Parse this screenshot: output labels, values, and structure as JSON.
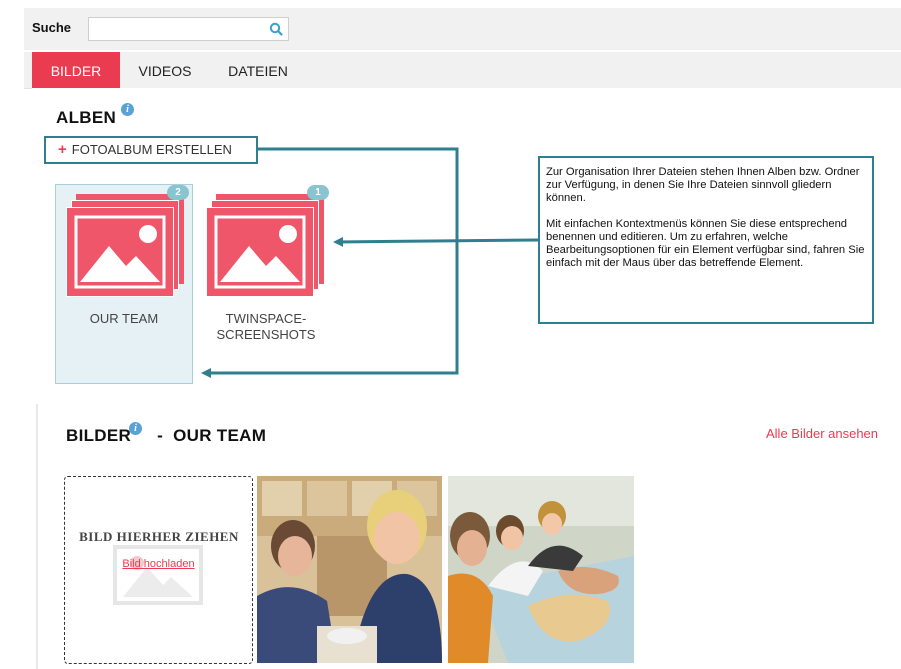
{
  "search": {
    "label": "Suche",
    "value": "",
    "placeholder": ""
  },
  "tabs": [
    {
      "label": "BILDER",
      "active": true
    },
    {
      "label": "VIDEOS",
      "active": false
    },
    {
      "label": "DATEIEN",
      "active": false
    }
  ],
  "albums_section": {
    "heading": "ALBEN",
    "info": "i",
    "create_button": {
      "plus": "+",
      "label": "FOTOALBUM ERSTELLEN"
    },
    "albums": [
      {
        "title": "OUR TEAM",
        "count": "2",
        "selected": true
      },
      {
        "title_line1": "TWINSPACE-",
        "title_line2": "SCREENSHOTS",
        "count": "1",
        "selected": false
      }
    ]
  },
  "callout": {
    "paragraph1": "Zur Organisation Ihrer Dateien stehen Ihnen Alben bzw. Ordner zur Verfügung, in denen Sie Ihre Dateien sinnvoll gliedern können.",
    "paragraph2": "Mit einfachen Kontextmenüs können Sie diese entsprechend benennen und editieren. Um zu erfahren, welche Bearbeitungsoptionen für ein Element verfügbar sind, fahren Sie einfach mit der Maus über das betreffende Element."
  },
  "images_section": {
    "heading_prefix": "BILDER",
    "info": "i",
    "separator": "-",
    "album_name": "OUR TEAM",
    "view_all_link": "Alle Bilder ansehen",
    "drop_zone_text": "BILD HIERHER ZIEHEN",
    "upload_link": "Bild hochladen"
  },
  "colors": {
    "accent": "#ea3b50",
    "callout_border": "#2f7f8f",
    "album_icon": "#f0566a",
    "badge": "#8ac4d1",
    "info": "#5aa2d6"
  }
}
